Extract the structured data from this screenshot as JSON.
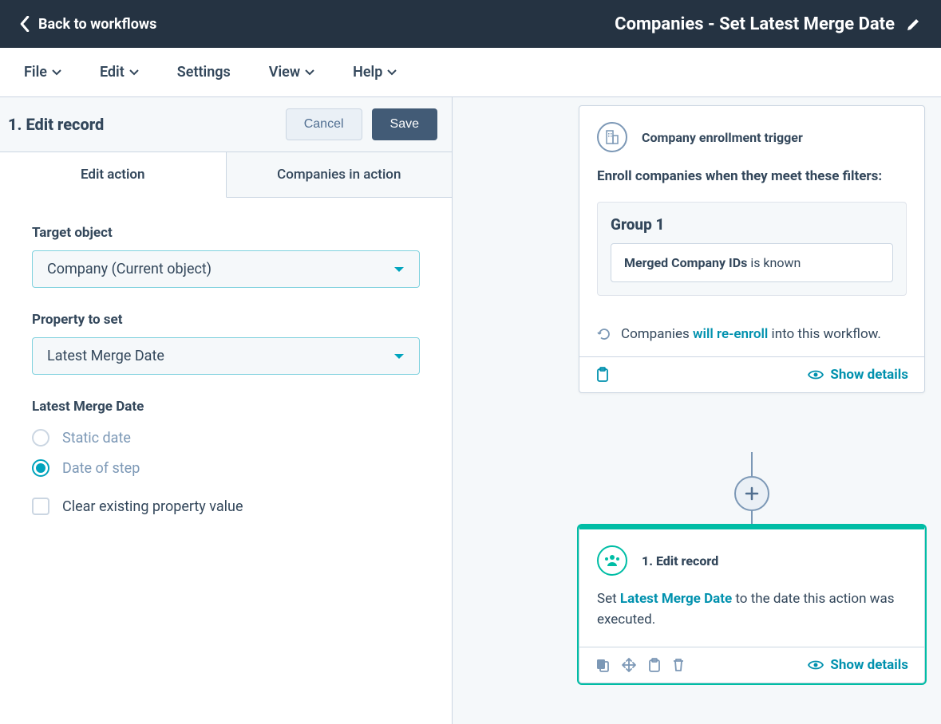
{
  "header": {
    "back_label": "Back to workflows",
    "title": "Companies - Set Latest Merge Date"
  },
  "menu": {
    "file": "File",
    "edit": "Edit",
    "settings": "Settings",
    "view": "View",
    "help": "Help"
  },
  "panel": {
    "title": "1. Edit record",
    "cancel": "Cancel",
    "save": "Save",
    "tabs": {
      "edit_action": "Edit action",
      "companies_in_action": "Companies in action"
    },
    "form": {
      "target_label": "Target object",
      "target_value": "Company (Current object)",
      "property_label": "Property to set",
      "property_value": "Latest Merge Date",
      "section_label": "Latest Merge Date",
      "radio_static": "Static date",
      "radio_step": "Date of step",
      "clear_label": "Clear existing property value"
    }
  },
  "trigger": {
    "title": "Company enrollment trigger",
    "desc": "Enroll companies when they meet these filters:",
    "group_title": "Group 1",
    "filter_property": "Merged Company IDs",
    "filter_condition": " is known",
    "reenroll_prefix": "Companies ",
    "reenroll_link": "will re-enroll",
    "reenroll_suffix": " into this workflow.",
    "show_details": "Show details"
  },
  "action": {
    "title": "1. Edit record",
    "desc_prefix": "Set ",
    "desc_property": "Latest Merge Date",
    "desc_suffix": " to the date this action was executed.",
    "show_details": "Show details"
  }
}
